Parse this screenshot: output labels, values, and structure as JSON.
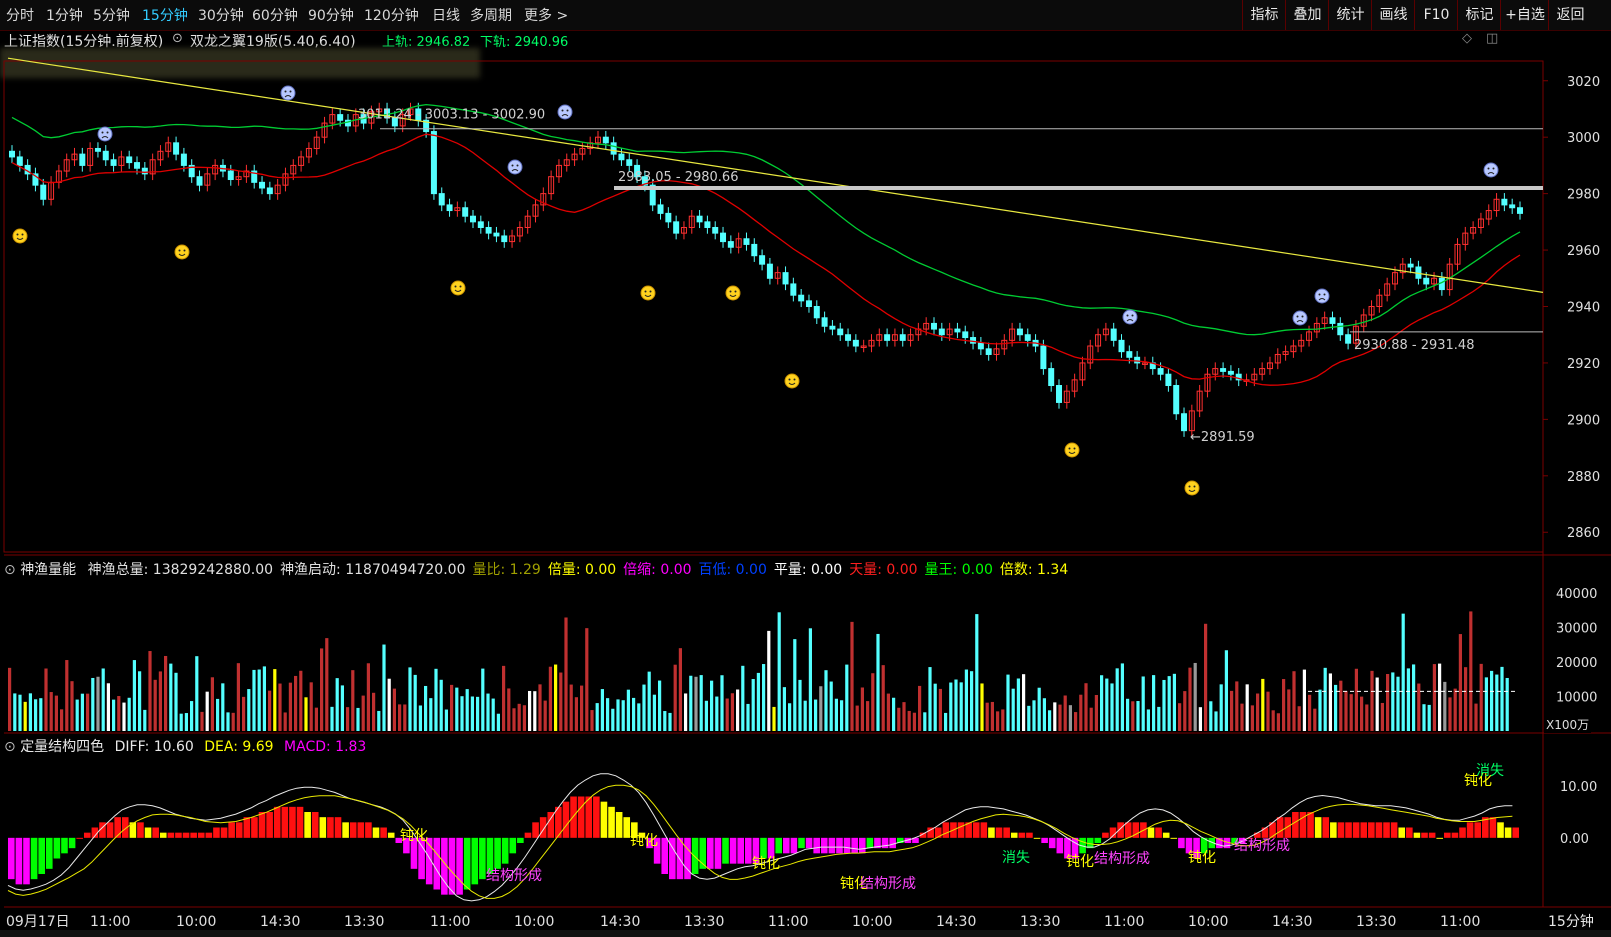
{
  "toolbar": {
    "timeframes": [
      "分时",
      "1分钟",
      "5分钟",
      "15分钟",
      "30分钟",
      "60分钟",
      "90分钟",
      "120分钟",
      "日线",
      "多周期",
      "更多 >"
    ],
    "active_timeframe": "15分钟",
    "buttons": [
      "指标",
      "叠加",
      "统计",
      "画线",
      "F10",
      "标记",
      "+自选",
      "返回"
    ]
  },
  "main_panel": {
    "title": "上证指数(15分钟.前复权)",
    "indicator": "双龙之翼19版(5.40,6.40)",
    "upper_label": "上轨: 2946.82",
    "lower_label": "下轨: 2940.96",
    "annotations": [
      "3011.24 - 3003.13 - 3002.90",
      "2983.05 - 2980.66",
      "2930.88 - 2931.48",
      "2891.59"
    ]
  },
  "volume_panel": {
    "name": "神渔量能",
    "items": [
      {
        "label": "神渔总量:",
        "value": "13829242880.00",
        "color": "#e0e0e0"
      },
      {
        "label": "神渔启动:",
        "value": "11870494720.00",
        "color": "#e0e0e0"
      },
      {
        "label": "量比:",
        "value": "1.29",
        "color": "#a0a000"
      },
      {
        "label": "倍量:",
        "value": "0.00",
        "color": "#ffff00"
      },
      {
        "label": "倍缩:",
        "value": "0.00",
        "color": "#ff00ff"
      },
      {
        "label": "百低:",
        "value": "0.00",
        "color": "#0040ff"
      },
      {
        "label": "平量:",
        "value": "0.00",
        "color": "#ffffff"
      },
      {
        "label": "天量:",
        "value": "0.00",
        "color": "#ff2020"
      },
      {
        "label": "量王:",
        "value": "0.00",
        "color": "#00ff00"
      },
      {
        "label": "倍数:",
        "value": "1.34",
        "color": "#ffff00"
      }
    ],
    "unit": "X100万"
  },
  "macd_panel": {
    "name": "定量结构四色",
    "diff_label": "DIFF: 10.60",
    "dea_label": "DEA: 9.69",
    "macd_label": "MACD: 1.83",
    "text_marks": [
      "钝化",
      "结构形成",
      "消失"
    ]
  },
  "x_axis": {
    "labels": [
      "09月17日",
      "11:00",
      "10:00",
      "14:30",
      "13:30",
      "11:00",
      "10:00",
      "14:30",
      "13:30",
      "11:00",
      "10:00",
      "14:30",
      "13:30",
      "11:00",
      "10:00",
      "14:30",
      "13:30",
      "11:00"
    ],
    "period_badge": "15分钟"
  },
  "colors": {
    "up": "#ff3030",
    "down": "#54ffff",
    "grid": "#7a0000",
    "ma_green": "#00cc33",
    "ma_red": "#e00000",
    "trend": "#e8e840",
    "diff": "#e8e8e8",
    "dea": "#e8e800"
  },
  "chart_data": [
    {
      "type": "candlestick",
      "title": "上证指数(15分钟.前复权)",
      "y_ticks": [
        3020,
        3000,
        2980,
        2960,
        2940,
        2920,
        2900,
        2880,
        2860
      ],
      "ylim": [
        2853,
        3027
      ],
      "close": [
        2993,
        2990,
        2987,
        2983,
        2978,
        2984,
        2988,
        2992,
        2994,
        2990,
        2996,
        2995,
        2992,
        2990,
        2993,
        2991,
        2989,
        2987,
        2992,
        2995,
        2998,
        2994,
        2990,
        2986,
        2983,
        2987,
        2990,
        2988,
        2985,
        2986,
        2988,
        2984,
        2982,
        2980,
        2983,
        2987,
        2990,
        2993,
        2996,
        3000,
        3005,
        3008,
        3006,
        3004,
        3008,
        3005,
        3009,
        3010,
        3007,
        3004,
        3008,
        3010,
        3006,
        3002,
        2980,
        2976,
        2974,
        2975,
        2972,
        2970,
        2968,
        2966,
        2965,
        2963,
        2965,
        2968,
        2972,
        2976,
        2980,
        2986,
        2990,
        2992,
        2994,
        2996,
        2998,
        3000,
        2998,
        2994,
        2992,
        2990,
        2986,
        2983,
        2976,
        2973,
        2970,
        2966,
        2968,
        2972,
        2970,
        2968,
        2966,
        2963,
        2961,
        2964,
        2962,
        2958,
        2955,
        2950,
        2952,
        2948,
        2944,
        2942,
        2940,
        2936,
        2933,
        2932,
        2930,
        2928,
        2926,
        2926,
        2928,
        2930,
        2928,
        2930,
        2928,
        2930,
        2932,
        2934,
        2932,
        2930,
        2932,
        2931,
        2929,
        2927,
        2925,
        2923,
        2925,
        2928,
        2932,
        2930,
        2928,
        2926,
        2918,
        2912,
        2906,
        2910,
        2914,
        2920,
        2926,
        2930,
        2932,
        2928,
        2924,
        2922,
        2920,
        2920,
        2918,
        2916,
        2912,
        2902,
        2896,
        2903,
        2910,
        2916,
        2918,
        2917,
        2916,
        2914,
        2914,
        2916,
        2918,
        2920,
        2923,
        2924,
        2926,
        2928,
        2931,
        2934,
        2936,
        2934,
        2930,
        2927,
        2933,
        2937,
        2940,
        2944,
        2948,
        2952,
        2955,
        2954,
        2950,
        2948,
        2950,
        2946,
        2955,
        2962,
        2966,
        2968,
        2971,
        2974,
        2978,
        2976,
        2975,
        2973
      ],
      "ma_green_start": 3014,
      "ma_green_end": 2946,
      "ma_red_start": 2998,
      "ma_red_end": 2941
    },
    {
      "type": "bar",
      "title": "神渔量能",
      "y_ticks": [
        40000,
        30000,
        20000,
        10000
      ],
      "ylim": [
        0,
        45000
      ],
      "values_seed": 17
    },
    {
      "type": "bar",
      "title": "定量结构四色",
      "y_ticks": [
        10.0,
        0.0
      ],
      "ylim": [
        -13,
        17
      ],
      "values": [
        -8,
        -9,
        -9,
        -8,
        -7,
        -6,
        -4,
        -3,
        -2,
        0,
        1,
        2,
        3,
        3,
        4,
        4,
        3,
        3,
        2,
        2,
        1,
        1,
        1,
        1,
        1,
        1,
        1,
        2,
        2,
        3,
        3,
        4,
        4,
        5,
        5,
        6,
        6,
        6,
        6,
        5,
        5,
        4,
        4,
        4,
        3,
        3,
        3,
        3,
        2,
        2,
        1,
        -1,
        -3,
        -6,
        -8,
        -9,
        -10,
        -11,
        -11,
        -11,
        -10,
        -9,
        -8,
        -7,
        -6,
        -5,
        -3,
        -1,
        1,
        3,
        4,
        5,
        6,
        7,
        8,
        8,
        8,
        8,
        7,
        6,
        5,
        4,
        3,
        1,
        -2,
        -5,
        -7,
        -8,
        -8,
        -8,
        -7,
        -6,
        -6,
        -6,
        -5,
        -5,
        -5,
        -5,
        -5,
        -4,
        -4,
        -3,
        -3,
        -3,
        -2,
        -2,
        -3,
        -3,
        -3,
        -3,
        -3,
        -3,
        -3,
        -2,
        -2,
        -2,
        -2,
        -1,
        -1,
        -1,
        1,
        2,
        2,
        3,
        3,
        3,
        3,
        3,
        3,
        2,
        2,
        2,
        1,
        1,
        1,
        0,
        -1,
        -2,
        -3,
        -4,
        -4,
        -3,
        -2,
        -1,
        1,
        2,
        3,
        3,
        3,
        3,
        2,
        2,
        1,
        0,
        -2,
        -3,
        -4,
        -3,
        -2,
        -2,
        -2,
        -1,
        -1,
        0,
        1,
        2,
        3,
        4,
        4,
        5,
        5,
        5,
        4,
        4,
        3,
        3,
        3,
        3,
        3,
        3,
        3,
        3,
        3,
        2,
        2,
        1,
        1,
        1,
        0,
        1,
        1,
        2,
        3,
        3,
        4,
        4,
        3,
        2,
        2
      ]
    }
  ]
}
